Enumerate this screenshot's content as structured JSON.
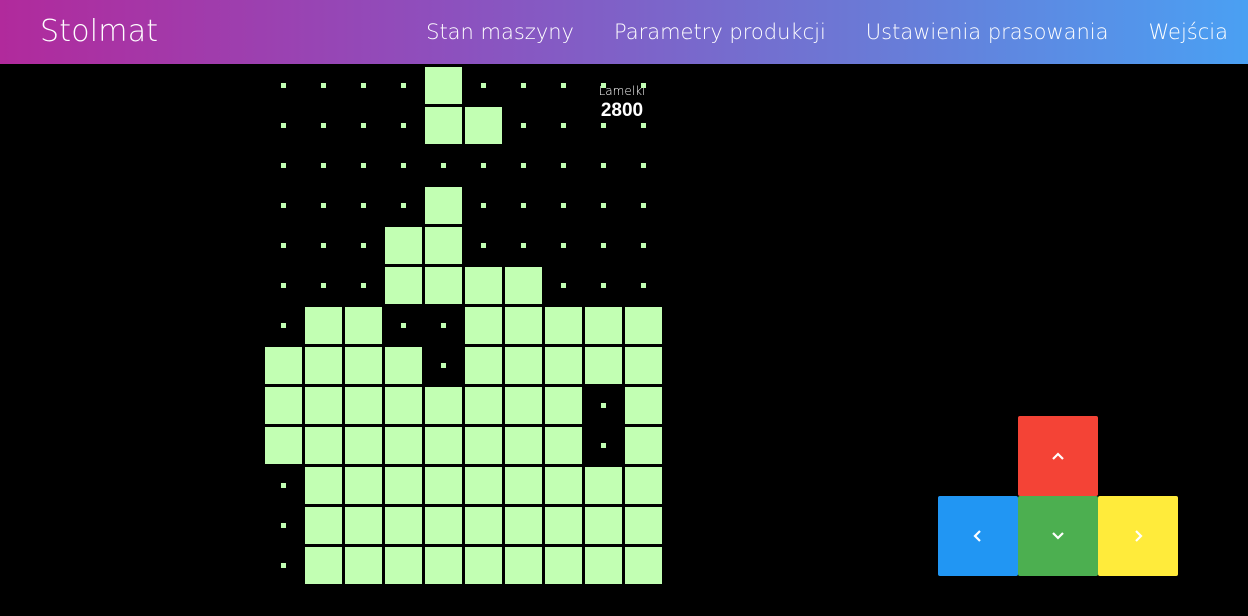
{
  "app": {
    "title": "Stolmat"
  },
  "nav": {
    "items": [
      {
        "label": "Stan maszyny"
      },
      {
        "label": "Parametry produkcji"
      },
      {
        "label": "Ustawienia prasowania"
      },
      {
        "label": "Wejścia"
      }
    ]
  },
  "game": {
    "score_label": "Lamelki",
    "score_value": "2800",
    "cell_color": "#c2ffb3",
    "rows": [
      "0000100000",
      "0000110000",
      "0000000000",
      "0000100000",
      "0001100000",
      "0001111000",
      "0110011111",
      "1111011111",
      "1111111101",
      "1111111101",
      "0111111111",
      "0111111111",
      "0111111111"
    ]
  },
  "controls": {
    "up": {
      "icon": "chevron-up-icon",
      "color": "#f44336"
    },
    "left": {
      "icon": "chevron-left-icon",
      "color": "#2196f3"
    },
    "down": {
      "icon": "chevron-down-icon",
      "color": "#4caf50"
    },
    "right": {
      "icon": "chevron-right-icon",
      "color": "#ffeb3b"
    }
  }
}
